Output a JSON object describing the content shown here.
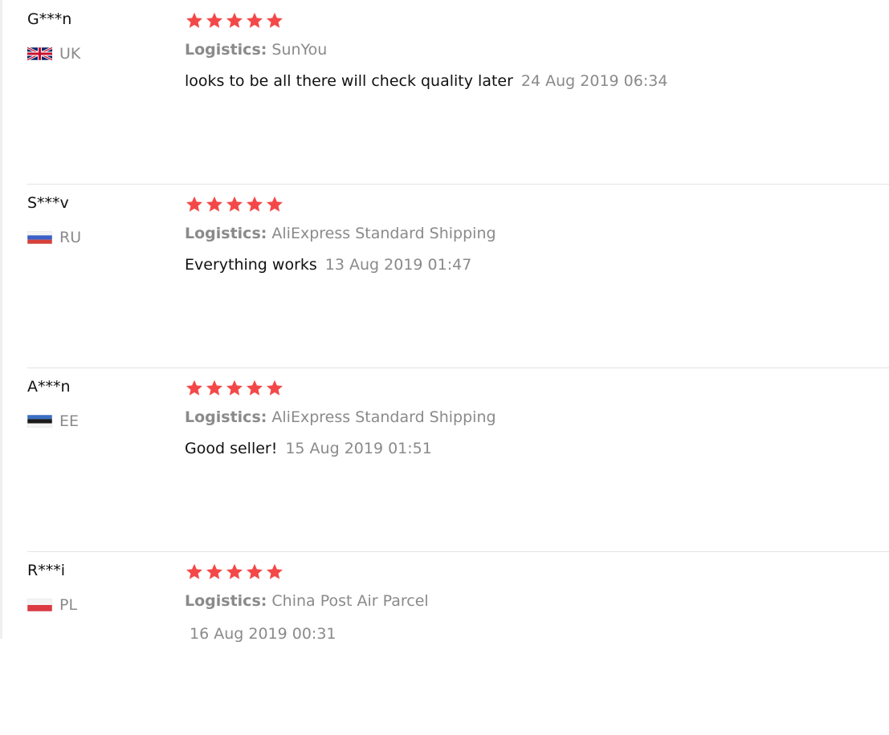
{
  "reviews": [
    {
      "user": "G***n",
      "country_code": "UK",
      "flag_icon": "uk-flag-icon",
      "rating": 5,
      "logistics_label": "Logistics:",
      "logistics_value": "SunYou",
      "comment": "looks to be all there will check quality later",
      "date": "24 Aug 2019 06:34"
    },
    {
      "user": "S***v",
      "country_code": "RU",
      "flag_icon": "ru-flag-icon",
      "rating": 5,
      "logistics_label": "Logistics:",
      "logistics_value": "AliExpress Standard Shipping",
      "comment": "Everything works",
      "date": "13 Aug 2019 01:47"
    },
    {
      "user": "A***n",
      "country_code": "EE",
      "flag_icon": "ee-flag-icon",
      "rating": 5,
      "logistics_label": "Logistics:",
      "logistics_value": "AliExpress Standard Shipping",
      "comment": "Good seller!",
      "date": "15 Aug 2019 01:51"
    },
    {
      "user": "R***i",
      "country_code": "PL",
      "flag_icon": "pl-flag-icon",
      "rating": 5,
      "logistics_label": "Logistics:",
      "logistics_value": "China Post Air Parcel",
      "comment": "",
      "date": "16 Aug 2019 00:31"
    }
  ],
  "colors": {
    "star": "#f44848",
    "muted_text": "#8a8a8a",
    "divider": "#e3e3e3"
  }
}
